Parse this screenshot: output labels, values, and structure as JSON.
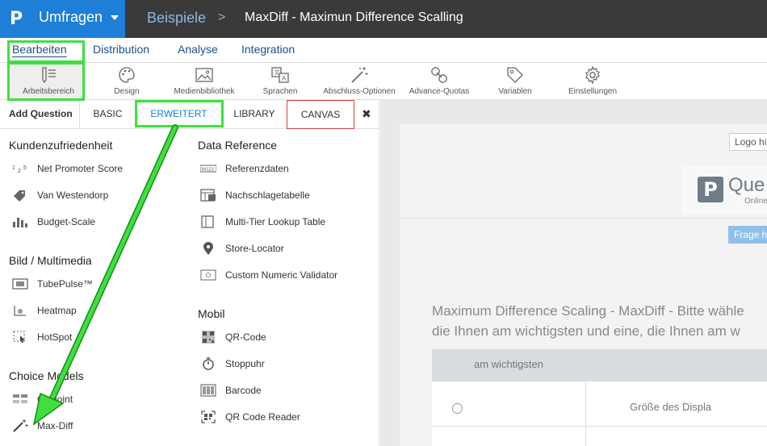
{
  "topbar": {
    "logo": "P",
    "app_title": "Umfragen",
    "breadcrumb_link": "Beispiele",
    "breadcrumb_sep": ">",
    "breadcrumb_current": "MaxDiff - Maximun Difference Scalling"
  },
  "tabs": [
    "Bearbeiten",
    "Distribution",
    "Analyse",
    "Integration"
  ],
  "toolbar": [
    {
      "label": "Arbeitsbereich",
      "icon": "pencil-lines-icon"
    },
    {
      "label": "Design",
      "icon": "palette-icon"
    },
    {
      "label": "Medienbibliothek",
      "icon": "image-icon"
    },
    {
      "label": "Sprachen",
      "icon": "translate-icon"
    },
    {
      "label": "Abschluss-Optionen",
      "icon": "magic-wand-icon"
    },
    {
      "label": "Advance-Quotas",
      "icon": "link-icon"
    },
    {
      "label": "Variablen",
      "icon": "tag-icon"
    },
    {
      "label": "Einstellungen",
      "icon": "gear-icon"
    }
  ],
  "question_tabs": {
    "add": "Add Question",
    "basic": "BASIC",
    "erweitert": "ERWEITERT",
    "library": "LIBRARY",
    "canvas": "CANVAS",
    "close": "✖"
  },
  "sections": {
    "kundenzufriedenheit": {
      "title": "Kundenzufriedenheit",
      "items": [
        "Net Promoter Score",
        "Van Westendorp",
        "Budget-Scale"
      ]
    },
    "bild": {
      "title": "Bild / Multimedia",
      "items": [
        "TubePulse™",
        "Heatmap",
        "HotSpot"
      ]
    },
    "choice": {
      "title": "Choice Models",
      "items": [
        "Conjoint",
        "Max-Diff"
      ]
    },
    "data_reference": {
      "title": "Data Reference",
      "items": [
        "Referenzdaten",
        "Nachschlagetabelle",
        "Multi-Tier Lookup Table",
        "Store-Locator",
        "Custom Numeric Validator"
      ]
    },
    "mobil": {
      "title": "Mobil",
      "items": [
        "QR-Code",
        "Stoppuhr",
        "Barcode",
        "QR Code Reader"
      ]
    }
  },
  "canvas": {
    "logo_hint": "Logo hi",
    "logo_letter": "P",
    "logo_name": "Que",
    "logo_sub": "Online",
    "frage_button": "Frage hi",
    "question_line1": "Maximum Difference Scaling - MaxDiff - Bitte wähle",
    "question_line2": "die Ihnen am wichtigsten und eine, die Ihnen am w",
    "grid_header": "am wichtigsten",
    "grid_cell": "Größe des Displa"
  },
  "colors": {
    "topbar": "#3a3a3a",
    "brand_blue": "#1d7fd6",
    "highlight_green": "#3ee03e",
    "canvas_red": "#d04040"
  }
}
